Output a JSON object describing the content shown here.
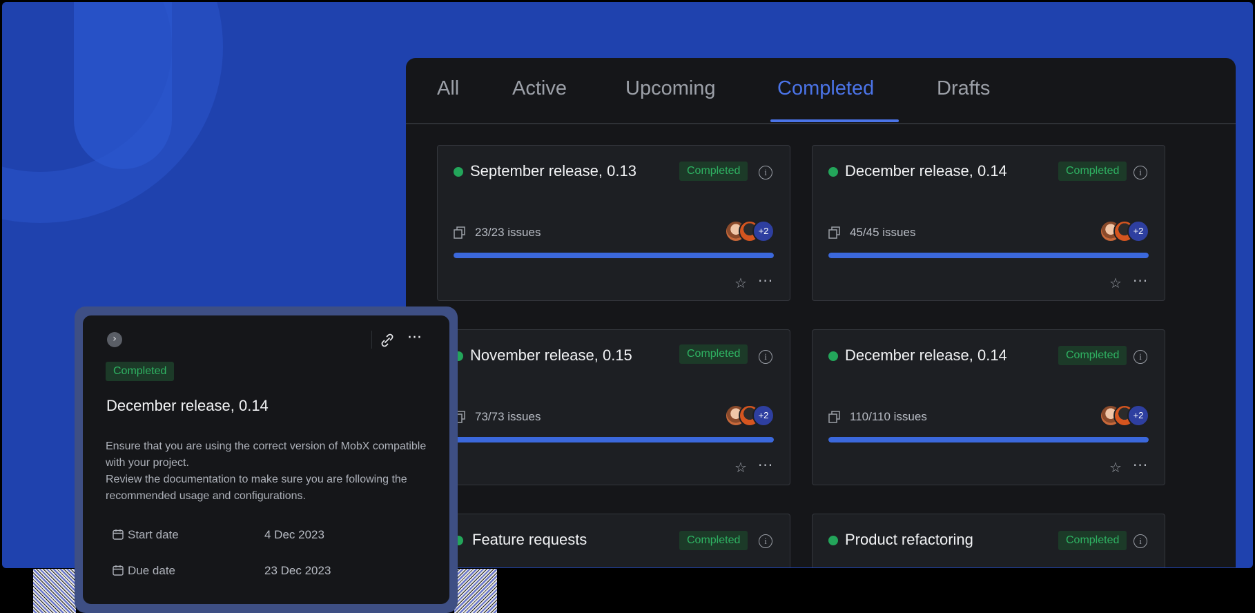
{
  "tabs": [
    {
      "label": "All"
    },
    {
      "label": "Active"
    },
    {
      "label": "Upcoming"
    },
    {
      "label": "Completed"
    },
    {
      "label": "Drafts"
    }
  ],
  "active_tab": "Completed",
  "accent_color": "#4b74e8",
  "status_color": "#2fb463",
  "releases": [
    {
      "title": "September release, 0.13",
      "status": "Completed",
      "issues": "23/23 issues",
      "progress": 1.0,
      "avatars_extra": "+2"
    },
    {
      "title": "December release, 0.14",
      "status": "Completed",
      "issues": "45/45 issues",
      "progress": 1.0,
      "avatars_extra": "+2"
    },
    {
      "title": "November release, 0.15",
      "status": "Completed",
      "issues": "73/73 issues",
      "progress": 1.0,
      "avatars_extra": "+2"
    },
    {
      "title": "December release, 0.14",
      "status": "Completed",
      "issues": "110/110 issues",
      "progress": 1.0,
      "avatars_extra": "+2"
    },
    {
      "title": "Feature requests",
      "status": "Completed"
    },
    {
      "title": "Product refactoring",
      "status": "Completed"
    }
  ],
  "detail": {
    "status": "Completed",
    "title": "December release, 0.14",
    "description": [
      "Ensure that you are using the correct version of MobX compatible with your project.",
      "Review the documentation to make sure you are following the recommended usage and configurations."
    ],
    "start_label": "Start date",
    "start_value": "4 Dec 2023",
    "due_label": "Due date",
    "due_value": "23 Dec 2023"
  },
  "icons": {
    "info": "info-icon",
    "issues": "issues-icon",
    "star": "star-icon",
    "more": "more-icon",
    "link": "link-icon",
    "chevron": "chevron-right-icon",
    "calendar": "calendar-icon"
  }
}
